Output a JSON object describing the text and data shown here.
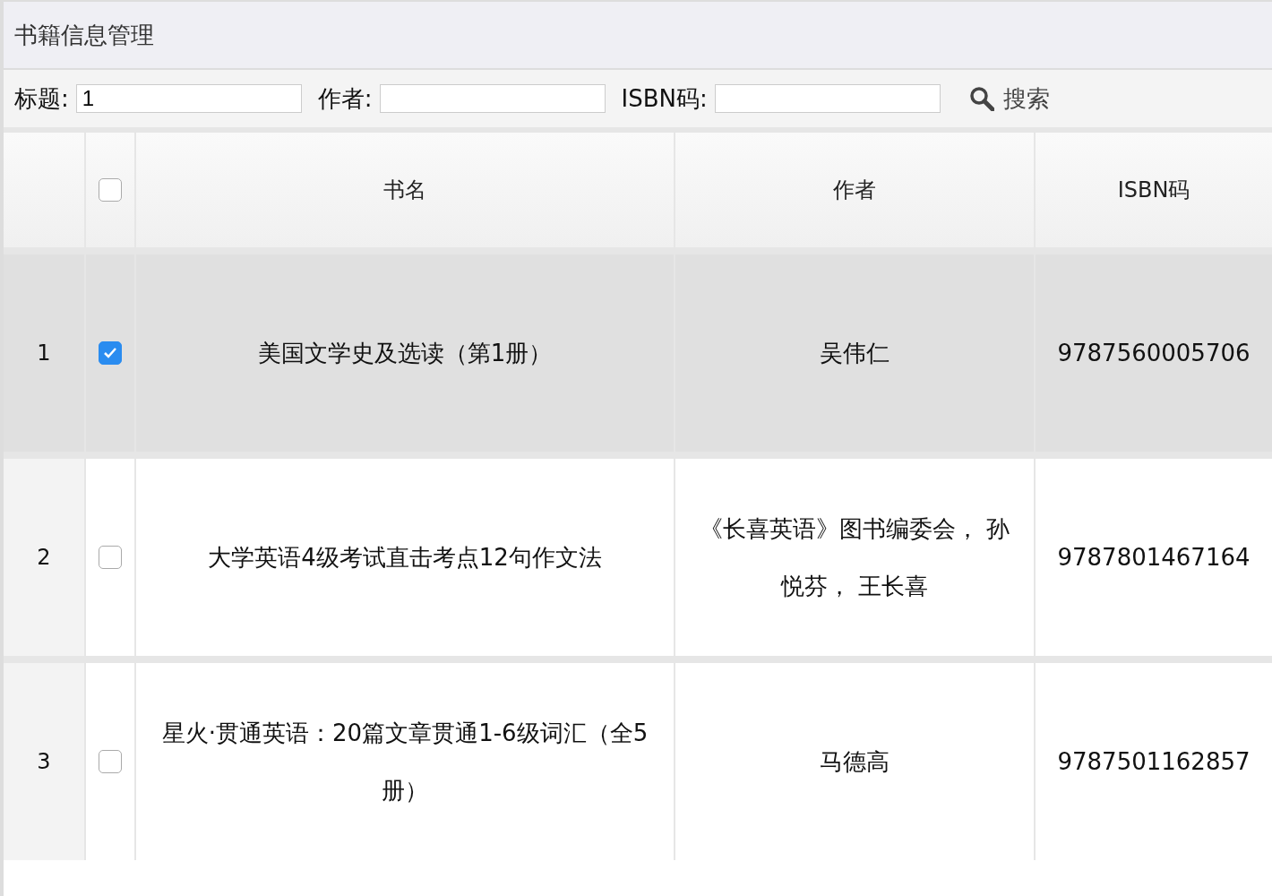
{
  "panel": {
    "title": "书籍信息管理"
  },
  "search": {
    "fields": [
      {
        "label": "标题:",
        "value": "1"
      },
      {
        "label": "作者:"
      },
      {
        "label": "ISBN码:"
      }
    ],
    "button": "搜索"
  },
  "table": {
    "columns": [
      "书名",
      "作者",
      "ISBN码"
    ],
    "header_checked": false,
    "rows": [
      {
        "number": "1",
        "selected": true,
        "title": "美国文学史及选读（第1册）",
        "author": "吴伟仁",
        "isbn": "9787560005706"
      },
      {
        "number": "2",
        "selected": false,
        "title": "大学英语4级考试直击考点12句作文法",
        "author": "《长喜英语》图书编委会， 孙悦芬， 王长喜",
        "isbn": "9787801467164"
      },
      {
        "number": "3",
        "selected": false,
        "title": "星火·贯通英语：20篇文章贯通1-6级词汇（全5册）",
        "author": "马德高",
        "isbn": "9787501162857"
      }
    ]
  }
}
